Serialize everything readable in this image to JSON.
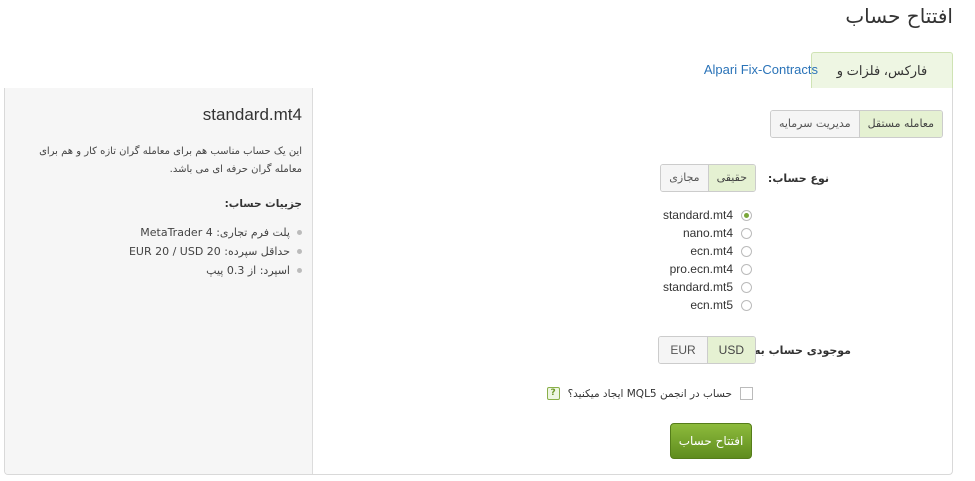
{
  "page": {
    "title": "افتتاح حساب"
  },
  "tabs": [
    {
      "label": "فارکس، فلزات و CFD",
      "active": true
    },
    {
      "label": "Alpari Fix-Contracts",
      "active": false
    }
  ],
  "form": {
    "mode_options": [
      {
        "label": "معامله مستقل",
        "selected": true
      },
      {
        "label": "مدیریت سرمایه",
        "selected": false
      }
    ],
    "account_type_label": "نوع حساب:",
    "account_type_options": [
      {
        "label": "حقیقی",
        "selected": true
      },
      {
        "label": "مجازی",
        "selected": false
      }
    ],
    "account_options": [
      {
        "label": "standard.mt4",
        "selected": true
      },
      {
        "label": "nano.mt4",
        "selected": false
      },
      {
        "label": "ecn.mt4",
        "selected": false
      },
      {
        "label": "pro.ecn.mt4",
        "selected": false
      },
      {
        "label": "standard.mt5",
        "selected": false
      },
      {
        "label": "ecn.mt5",
        "selected": false
      }
    ],
    "currency_label": "موجودی حساب به:",
    "currency_options": [
      {
        "label": "USD",
        "selected": true
      },
      {
        "label": "EUR",
        "selected": false
      }
    ],
    "mql5_checkbox_label": "حساب در انجمن MQL5 ایجاد میکنید؟",
    "mql5_checked": false,
    "help_icon_text": "?",
    "submit_label": "افتتاح حساب"
  },
  "info_panel": {
    "account_name": "standard.mt4",
    "description": "این یک حساب مناسب هم برای معامله گران تازه کار و هم برای معامله گران حرفه ای می باشد.",
    "details_title": "جزییات حساب:",
    "details": [
      "پلت فرم تجاری: MetaTrader 4",
      "حداقل سپرده: EUR 20 / USD 20",
      "اسپرد: از 0.3 پیپ"
    ]
  },
  "colors": {
    "accent_green": "#7aa63a",
    "tab_active_bg": "#eef6e3",
    "link_blue": "#2a73b8",
    "button_green": "#5f8c1e"
  }
}
